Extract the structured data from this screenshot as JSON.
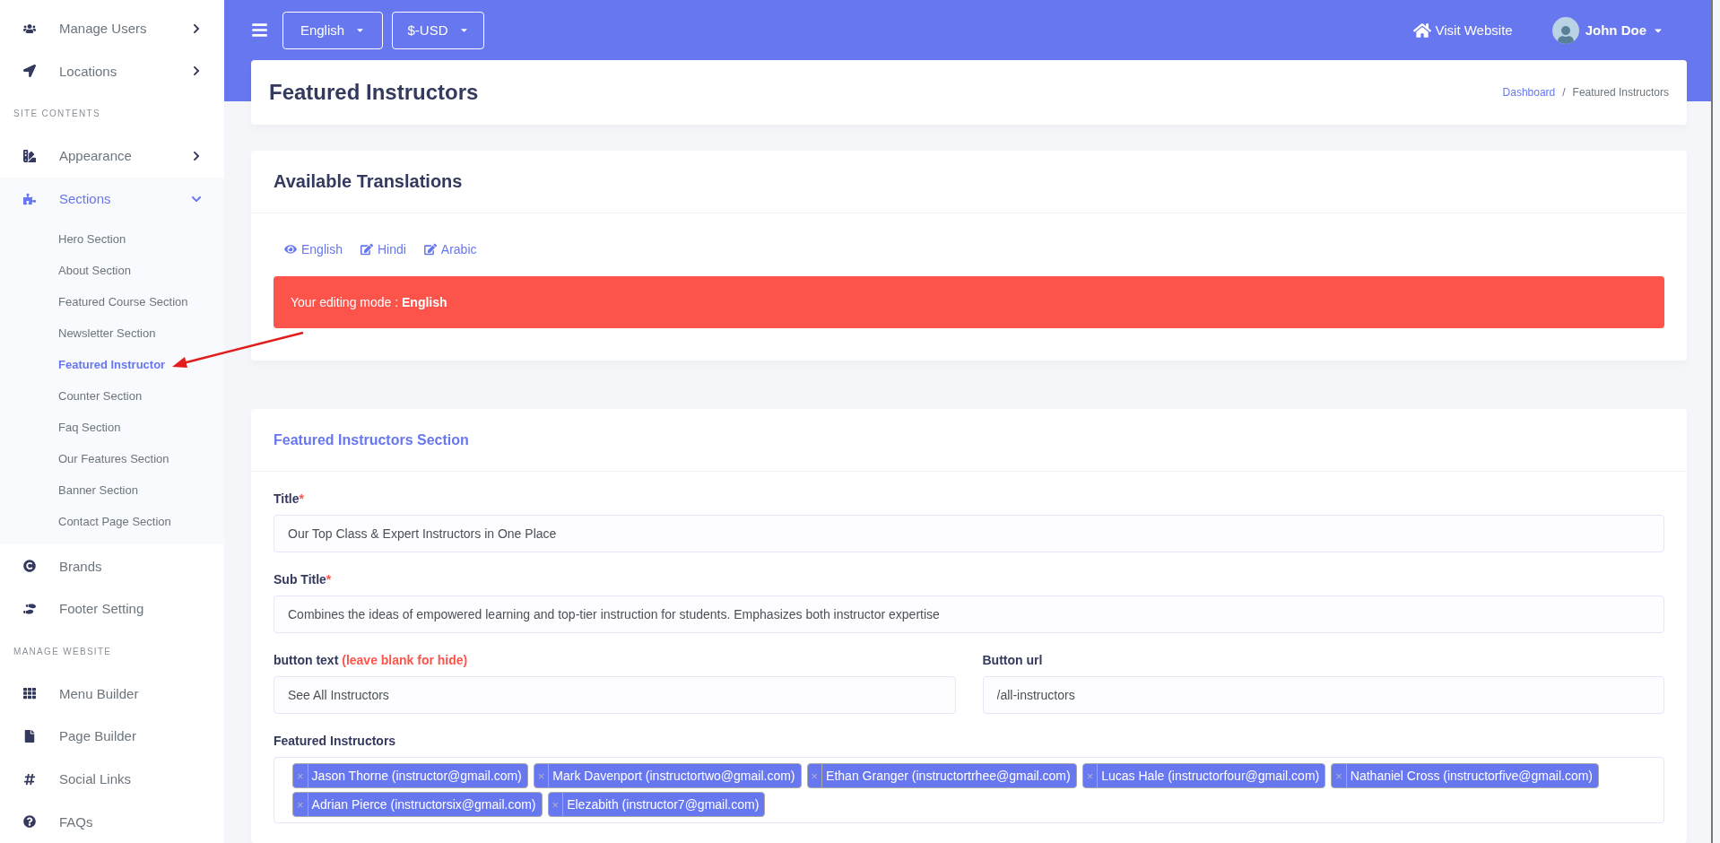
{
  "sidebar": {
    "items": [
      {
        "kind": "item",
        "label": "Manage Users",
        "expanded": false,
        "selected": false
      },
      {
        "kind": "item",
        "label": "Locations",
        "expanded": false,
        "selected": false
      },
      {
        "kind": "heading",
        "label": "SITE CONTENTS"
      },
      {
        "kind": "item",
        "label": "Appearance",
        "expanded": false,
        "selected": false
      },
      {
        "kind": "item",
        "label": "Sections",
        "expanded": true,
        "selected": true,
        "children": [
          {
            "label": "Hero Section",
            "selected": false
          },
          {
            "label": "About Section",
            "selected": false
          },
          {
            "label": "Featured Course Section",
            "selected": false
          },
          {
            "label": "Newsletter Section",
            "selected": false
          },
          {
            "label": "Featured Instructor",
            "selected": true
          },
          {
            "label": "Counter Section",
            "selected": false
          },
          {
            "label": "Faq Section",
            "selected": false
          },
          {
            "label": "Our Features Section",
            "selected": false
          },
          {
            "label": "Banner Section",
            "selected": false
          },
          {
            "label": "Contact Page Section",
            "selected": false
          }
        ]
      },
      {
        "kind": "item",
        "label": "Brands",
        "selected": false
      },
      {
        "kind": "item",
        "label": "Footer Setting",
        "selected": false
      },
      {
        "kind": "heading",
        "label": "MANAGE WEBSITE"
      },
      {
        "kind": "item",
        "label": "Menu Builder",
        "selected": false
      },
      {
        "kind": "item",
        "label": "Page Builder",
        "selected": false
      },
      {
        "kind": "item",
        "label": "Social Links",
        "selected": false
      },
      {
        "kind": "item",
        "label": "FAQs",
        "selected": false
      }
    ]
  },
  "topbar": {
    "language": "English",
    "currency": "$-USD",
    "visit_link": "Visit Website",
    "user": "John Doe"
  },
  "page_header": {
    "title": "Featured Instructors",
    "breadcrumb": [
      "Dashboard",
      "Featured Instructors"
    ],
    "separator": "/"
  },
  "translations": {
    "title": "Available Translations",
    "languages": [
      {
        "label": "English",
        "selected": true
      },
      {
        "label": "Hindi",
        "selected": false
      },
      {
        "label": "Arabic",
        "selected": false
      }
    ],
    "alert": "Your editing mode : **English**"
  },
  "form": {
    "title": "Featured Instructors Section",
    "fields": [
      {
        "label": "Title",
        "required_mark": "*",
        "value": "Our Top Class & Expert Instructors in One Place"
      },
      {
        "label": "Sub Title",
        "required_mark": "*",
        "value": "Combines the ideas of empowered learning and top-tier instruction for students. Emphasizes both instructor expertise"
      }
    ],
    "button_text": {
      "label": "button text",
      "hint": "(leave blank for hide)",
      "value": "See All Instructors"
    },
    "button_url": {
      "label": "Button url",
      "value": "/all-instructors"
    },
    "instructors": {
      "label": "Featured Instructors",
      "tags": [
        {
          "remove": "×",
          "label": "Jason Thorne (instructor@gmail.com)"
        },
        {
          "remove": "×",
          "label": "Mark Davenport (instructortwo@gmail.com)"
        },
        {
          "remove": "×",
          "label": "Ethan Granger (instructortrhee@gmail.com)"
        },
        {
          "remove": "×",
          "label": "Lucas Hale (instructorfour@gmail.com)"
        },
        {
          "remove": "×",
          "label": "Nathaniel Cross (instructorfive@gmail.com)"
        },
        {
          "remove": "×",
          "label": "Adrian Pierce (instructorsix@gmail.com)"
        },
        {
          "remove": "×",
          "label": "Elezabith (instructor7@gmail.com)"
        }
      ]
    }
  }
}
